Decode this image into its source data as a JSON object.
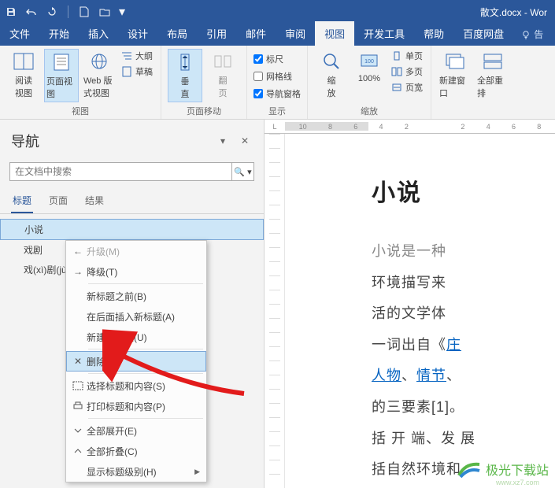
{
  "titlebar": {
    "doc_title": "散文.docx  -  Wor"
  },
  "tabs": {
    "file": "文件",
    "home": "开始",
    "insert": "插入",
    "design": "设计",
    "layout": "布局",
    "references": "引用",
    "mailings": "邮件",
    "review": "审阅",
    "view": "视图",
    "developer": "开发工具",
    "help": "帮助",
    "baidu": "百度网盘",
    "tell": "告"
  },
  "ribbon": {
    "views": {
      "read": "阅读\n视图",
      "print": "页面视图",
      "web": "Web 版式视图",
      "outline": "大纲",
      "draft": "草稿",
      "group": "视图"
    },
    "page_move": {
      "vertical": "垂\n直",
      "flip": "翻\n页",
      "group": "页面移动"
    },
    "show": {
      "ruler": "标尺",
      "gridlines": "网格线",
      "nav": "导航窗格",
      "group": "显示",
      "ruler_checked": true,
      "gridlines_checked": false,
      "nav_checked": true
    },
    "zoom": {
      "zoom": "缩\n放",
      "hundred": "100%",
      "one_page": "单页",
      "multi_page": "多页",
      "page_width": "页宽",
      "group": "缩放"
    },
    "window": {
      "new_window": "新建窗口",
      "arrange_all": "全部重排"
    }
  },
  "nav": {
    "title": "导航",
    "search_placeholder": "在文档中搜索",
    "tabs": {
      "headings": "标题",
      "pages": "页面",
      "results": "结果"
    },
    "items": [
      "小说",
      "戏剧",
      "戏(xì)剧(jù"
    ]
  },
  "context_menu": {
    "promote": "升级(M)",
    "demote": "降级(T)",
    "new_before": "新标题之前(B)",
    "insert_after": "在后面插入新标题(A)",
    "new_sub": "新建副标题(U)",
    "delete": "删除(D)",
    "select_content": "选择标题和内容(S)",
    "print_content": "打印标题和内容(P)",
    "expand_all": "全部展开(E)",
    "collapse_all": "全部折叠(C)",
    "show_levels": "显示标题级别(H)"
  },
  "hruler": {
    "nums_left": [
      "10",
      "8",
      "6",
      "4",
      "2"
    ],
    "nums_right": [
      "2",
      "4",
      "6",
      "8"
    ]
  },
  "doc": {
    "heading": "小说",
    "line1_gray": "小说是一种",
    "line2": "环境描写来",
    "line3": "活的文学体",
    "line4a": "一词出自《",
    "line4_link": "庄",
    "line5_link1": "人物",
    "line5_sep1": "、",
    "line5_link2": "情节",
    "line5_sep2": "、",
    "line6": "的三要素[1]。",
    "line7": "括 开 端、发 展",
    "line8": "括自然环境和"
  },
  "watermark": {
    "text": "极光下载站",
    "sub": "www.xz7.com"
  },
  "ruler_corner": "L"
}
